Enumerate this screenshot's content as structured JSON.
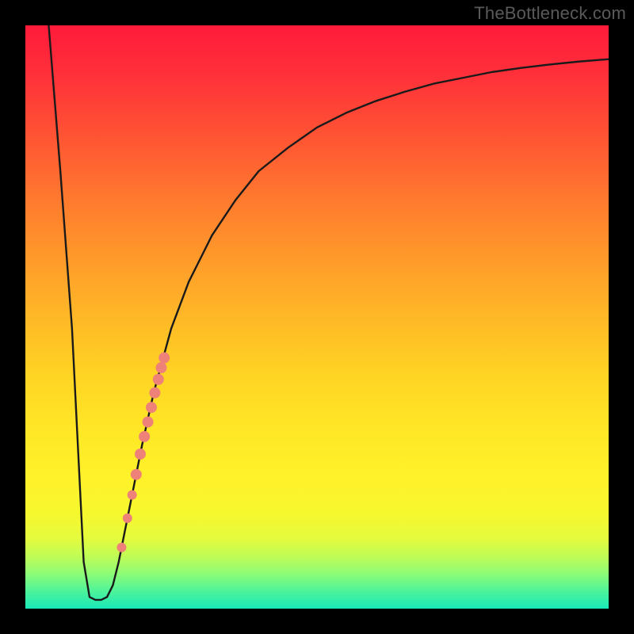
{
  "watermark": "TheBottleneck.com",
  "colors": {
    "curve": "#1a1a1a",
    "dots_fill": "#ef8278",
    "dots_stroke": "#d46a60"
  },
  "chart_data": {
    "type": "line",
    "title": "",
    "xlabel": "",
    "ylabel": "",
    "x_range": [
      0,
      100
    ],
    "y_range": [
      0,
      100
    ],
    "series": [
      {
        "name": "bottleneck-curve",
        "x": [
          4,
          6,
          8,
          9,
          10,
          11,
          12,
          13,
          14,
          15,
          16,
          18,
          20,
          22,
          25,
          28,
          32,
          36,
          40,
          45,
          50,
          55,
          60,
          65,
          70,
          75,
          80,
          85,
          90,
          95,
          100
        ],
        "y": [
          100,
          75,
          48,
          28,
          8,
          2,
          1.5,
          1.5,
          2,
          4,
          8,
          18,
          28,
          37,
          48,
          56,
          64,
          70,
          75,
          79,
          82.5,
          85,
          87,
          88.6,
          90,
          91,
          92,
          92.7,
          93.3,
          93.8,
          94.2
        ]
      }
    ],
    "scatter": {
      "name": "highlight-dots",
      "points": [
        {
          "x": 16.5,
          "y": 10.5,
          "r": 6
        },
        {
          "x": 17.5,
          "y": 15.5,
          "r": 6
        },
        {
          "x": 18.3,
          "y": 19.5,
          "r": 6
        },
        {
          "x": 19.0,
          "y": 23.0,
          "r": 7
        },
        {
          "x": 19.7,
          "y": 26.5,
          "r": 7
        },
        {
          "x": 20.4,
          "y": 29.5,
          "r": 7
        },
        {
          "x": 21.0,
          "y": 32.0,
          "r": 7
        },
        {
          "x": 21.6,
          "y": 34.5,
          "r": 7
        },
        {
          "x": 22.2,
          "y": 37.0,
          "r": 7
        },
        {
          "x": 22.8,
          "y": 39.3,
          "r": 7
        },
        {
          "x": 23.3,
          "y": 41.3,
          "r": 7
        },
        {
          "x": 23.8,
          "y": 43.0,
          "r": 7
        }
      ]
    }
  }
}
